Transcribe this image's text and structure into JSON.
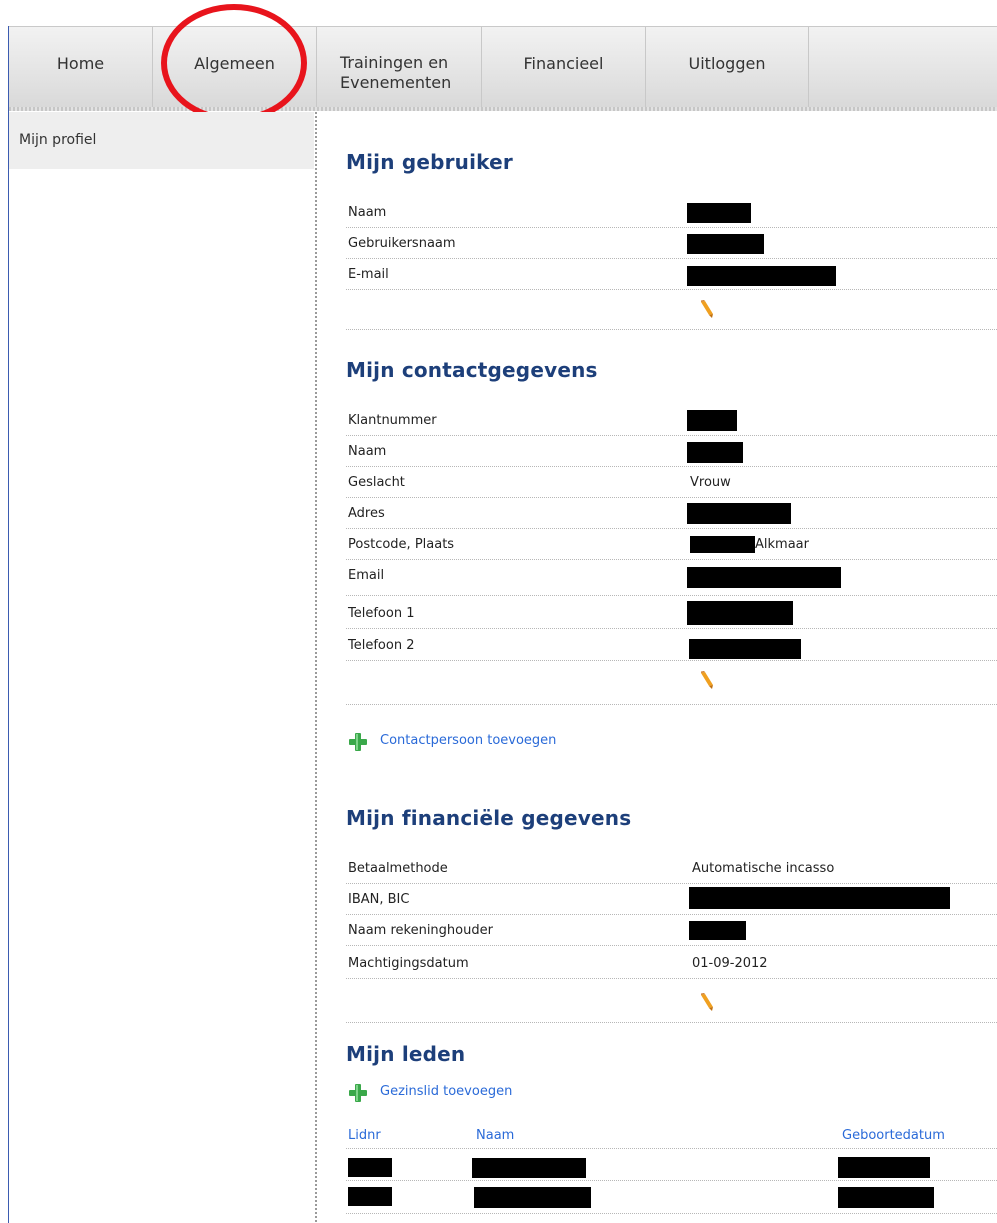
{
  "nav": {
    "items": [
      {
        "label": "Home"
      },
      {
        "label": "Algemeen"
      },
      {
        "label": "Trainingen en\nEvenementen"
      },
      {
        "label": "Financieel"
      },
      {
        "label": "Uitloggen"
      }
    ]
  },
  "sidebar": {
    "items": [
      {
        "label": "Mijn profiel"
      }
    ]
  },
  "user": {
    "title": "Mijn gebruiker",
    "rows": [
      {
        "label": "Naam"
      },
      {
        "label": "Gebruikersnaam"
      },
      {
        "label": "E-mail"
      }
    ]
  },
  "contact": {
    "title": "Mijn contactgegevens",
    "rows": [
      {
        "label": "Klantnummer",
        "value": ""
      },
      {
        "label": "Naam",
        "value": ""
      },
      {
        "label": "Geslacht",
        "value": "Vrouw"
      },
      {
        "label": "Adres",
        "value": ""
      },
      {
        "label": "Postcode, Plaats",
        "value": "Alkmaar"
      },
      {
        "label": "Email",
        "value": ""
      },
      {
        "label": "Telefoon 1",
        "value": ""
      },
      {
        "label": "Telefoon 2",
        "value": ""
      }
    ],
    "add_contact_label": "Contactpersoon toevoegen"
  },
  "financial": {
    "title": "Mijn financiële gegevens",
    "rows": [
      {
        "label": "Betaalmethode",
        "value": "Automatische incasso"
      },
      {
        "label": "IBAN, BIC",
        "value": ""
      },
      {
        "label": "Naam rekeninghouder",
        "value": ""
      },
      {
        "label": "Machtigingsdatum",
        "value": "01-09-2012"
      }
    ]
  },
  "members": {
    "title": "Mijn leden",
    "add_member_label": "Gezinslid toevoegen",
    "columns": [
      "Lidnr",
      "Naam",
      "Geboortedatum"
    ]
  },
  "colors": {
    "accent": "#1d3f7a",
    "link": "#2a6ad8",
    "highlight_ring": "#e8141c",
    "add_icon": "#3aa84a",
    "edit_icon": "#f0a020"
  },
  "icons": {
    "edit": "pencil-icon",
    "add": "plus-icon"
  }
}
